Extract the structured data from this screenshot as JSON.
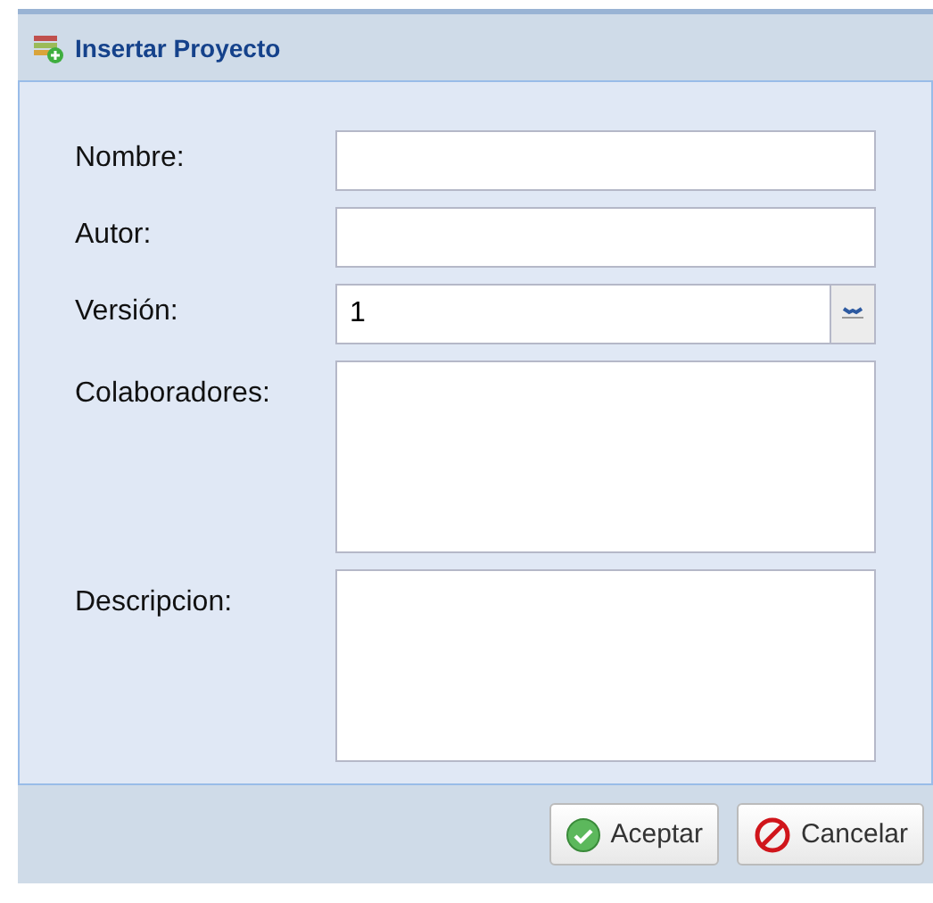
{
  "window": {
    "title": "Insertar Proyecto"
  },
  "fields": [
    {
      "label": "Nombre:",
      "kind": "text"
    },
    {
      "label": "Autor:",
      "kind": "text"
    },
    {
      "label": "Versión:",
      "kind": "number",
      "value": "1"
    },
    {
      "label": "Colaboradores:",
      "kind": "textarea"
    },
    {
      "label": "Descripcion:",
      "kind": "textarea"
    }
  ],
  "buttons": [
    {
      "label": "Aceptar",
      "kind": "ok"
    },
    {
      "label": "Cancelar",
      "kind": "cancel"
    }
  ]
}
